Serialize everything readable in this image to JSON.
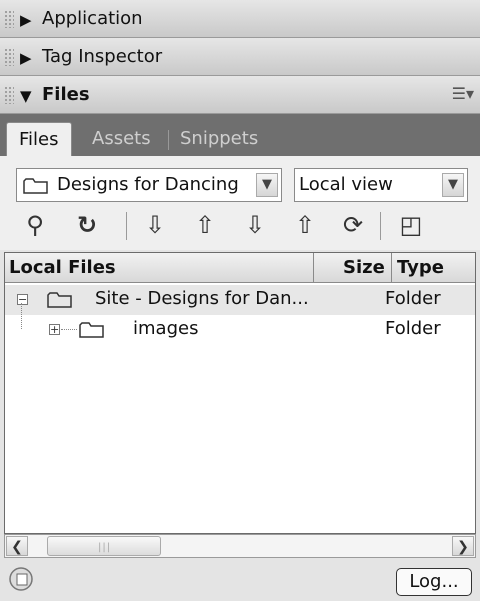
{
  "panels": {
    "application": {
      "title": "Application"
    },
    "tag_inspector": {
      "title": "Tag Inspector"
    },
    "files": {
      "title": "Files"
    }
  },
  "tabs": [
    {
      "label": "Files",
      "active": true
    },
    {
      "label": "Assets",
      "active": false
    },
    {
      "label": "Snippets",
      "active": false
    }
  ],
  "site_select": {
    "value": "Designs for Dancing"
  },
  "view_select": {
    "value": "Local view"
  },
  "toolbar": {
    "icons": [
      "connect-icon",
      "refresh-icon",
      "get-icon",
      "put-icon",
      "check-out-icon",
      "check-in-icon",
      "synchronize-icon",
      "expand-icon"
    ]
  },
  "file_list": {
    "columns": {
      "name": "Local Files",
      "size": "Size",
      "type": "Type"
    },
    "rows": [
      {
        "name": "Site - Designs for Dan...",
        "size": "",
        "type": "Folder",
        "expanded": true
      },
      {
        "name": "images",
        "size": "",
        "type": "Folder",
        "expanded": false
      }
    ]
  },
  "status": {
    "log_button": "Log..."
  },
  "colors": {
    "tab_bar": "#6f6f6f",
    "panel_bg": "#e4e4e4",
    "selected_row": "#e7e7e7"
  }
}
